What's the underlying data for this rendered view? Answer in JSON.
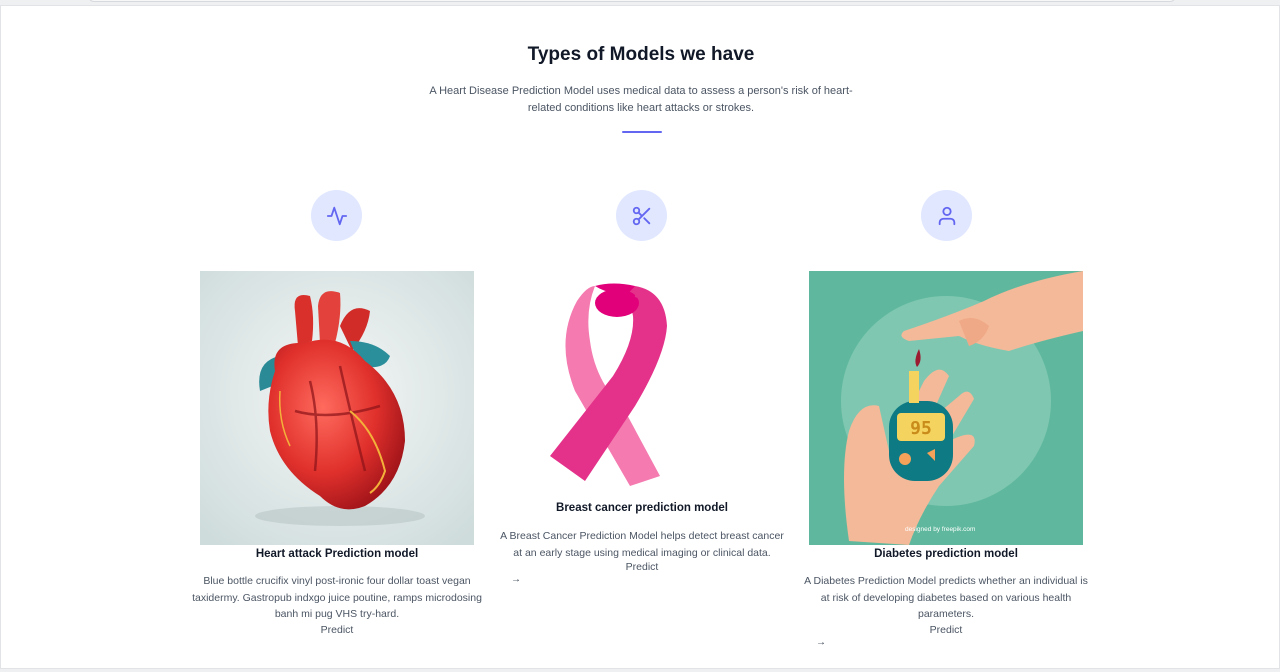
{
  "section": {
    "title": "Types of Models we have",
    "subtitle": "A Heart Disease Prediction Model uses medical data to assess a person's risk of heart-related conditions like heart attacks or strokes."
  },
  "cards": [
    {
      "icon": "activity-icon",
      "title": "Heart attack Prediction model",
      "description": "Blue bottle crucifix vinyl post-ironic four dollar toast vegan taxidermy. Gastropub indxgo juice poutine, ramps microdosing banh mi pug VHS try-hard.",
      "link": "Predict"
    },
    {
      "icon": "scissors-icon",
      "title": "Breast cancer prediction model",
      "description": "A Breast Cancer Prediction Model helps detect breast cancer at an early stage using medical imaging or clinical data.",
      "link": "Predict"
    },
    {
      "icon": "user-icon",
      "title": "Diabetes prediction model",
      "description": "A Diabetes Prediction Model predicts whether an individual is at risk of developing diabetes based on various health parameters.",
      "link": "Predict",
      "image_caption": "designed by freepik.com",
      "meter_reading": "95"
    }
  ],
  "colors": {
    "accent": "#6366f1",
    "icon_bg": "#e0e7ff",
    "diabetes_bg": "#5fb89d",
    "ribbon": "#f0599e"
  }
}
